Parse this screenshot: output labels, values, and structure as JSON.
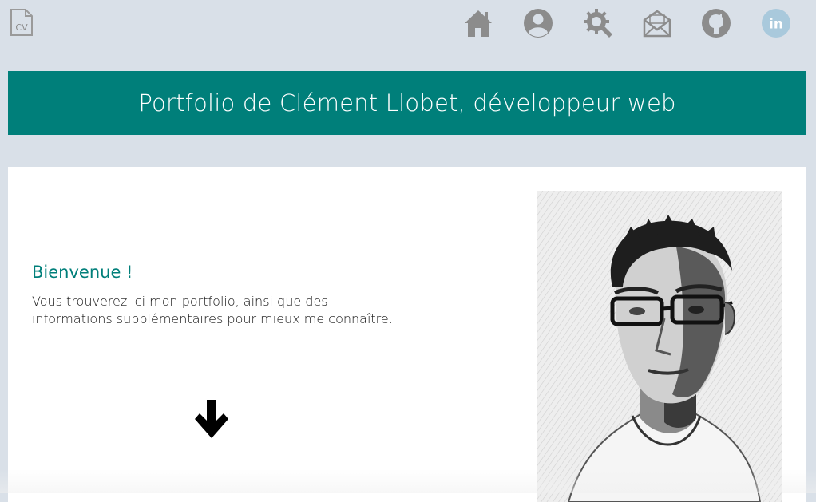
{
  "header": {
    "cv_icon": "cv-document-icon",
    "cv_label": "CV",
    "nav": [
      {
        "name": "home",
        "icon": "home-icon"
      },
      {
        "name": "profile",
        "icon": "user-icon"
      },
      {
        "name": "skills",
        "icon": "gear-badge-icon"
      },
      {
        "name": "contact",
        "icon": "envelope-icon"
      },
      {
        "name": "github",
        "icon": "github-icon"
      },
      {
        "name": "linkedin",
        "icon": "linkedin-icon",
        "label": "in"
      }
    ],
    "nav_color": "#8c8c8c",
    "linkedin_color": "#a9c9dc"
  },
  "banner": {
    "title": "Portfolio de Clément Llobet, développeur web",
    "background": "#007f7a"
  },
  "intro": {
    "heading": "Bienvenue !",
    "text": "Vous trouverez ici mon portfolio, ainsi que des informations supplémentaires pour mieux me connaître.",
    "scroll_icon": "arrow-down-icon"
  },
  "portrait": {
    "alt": "Portrait of Clément Llobet"
  }
}
